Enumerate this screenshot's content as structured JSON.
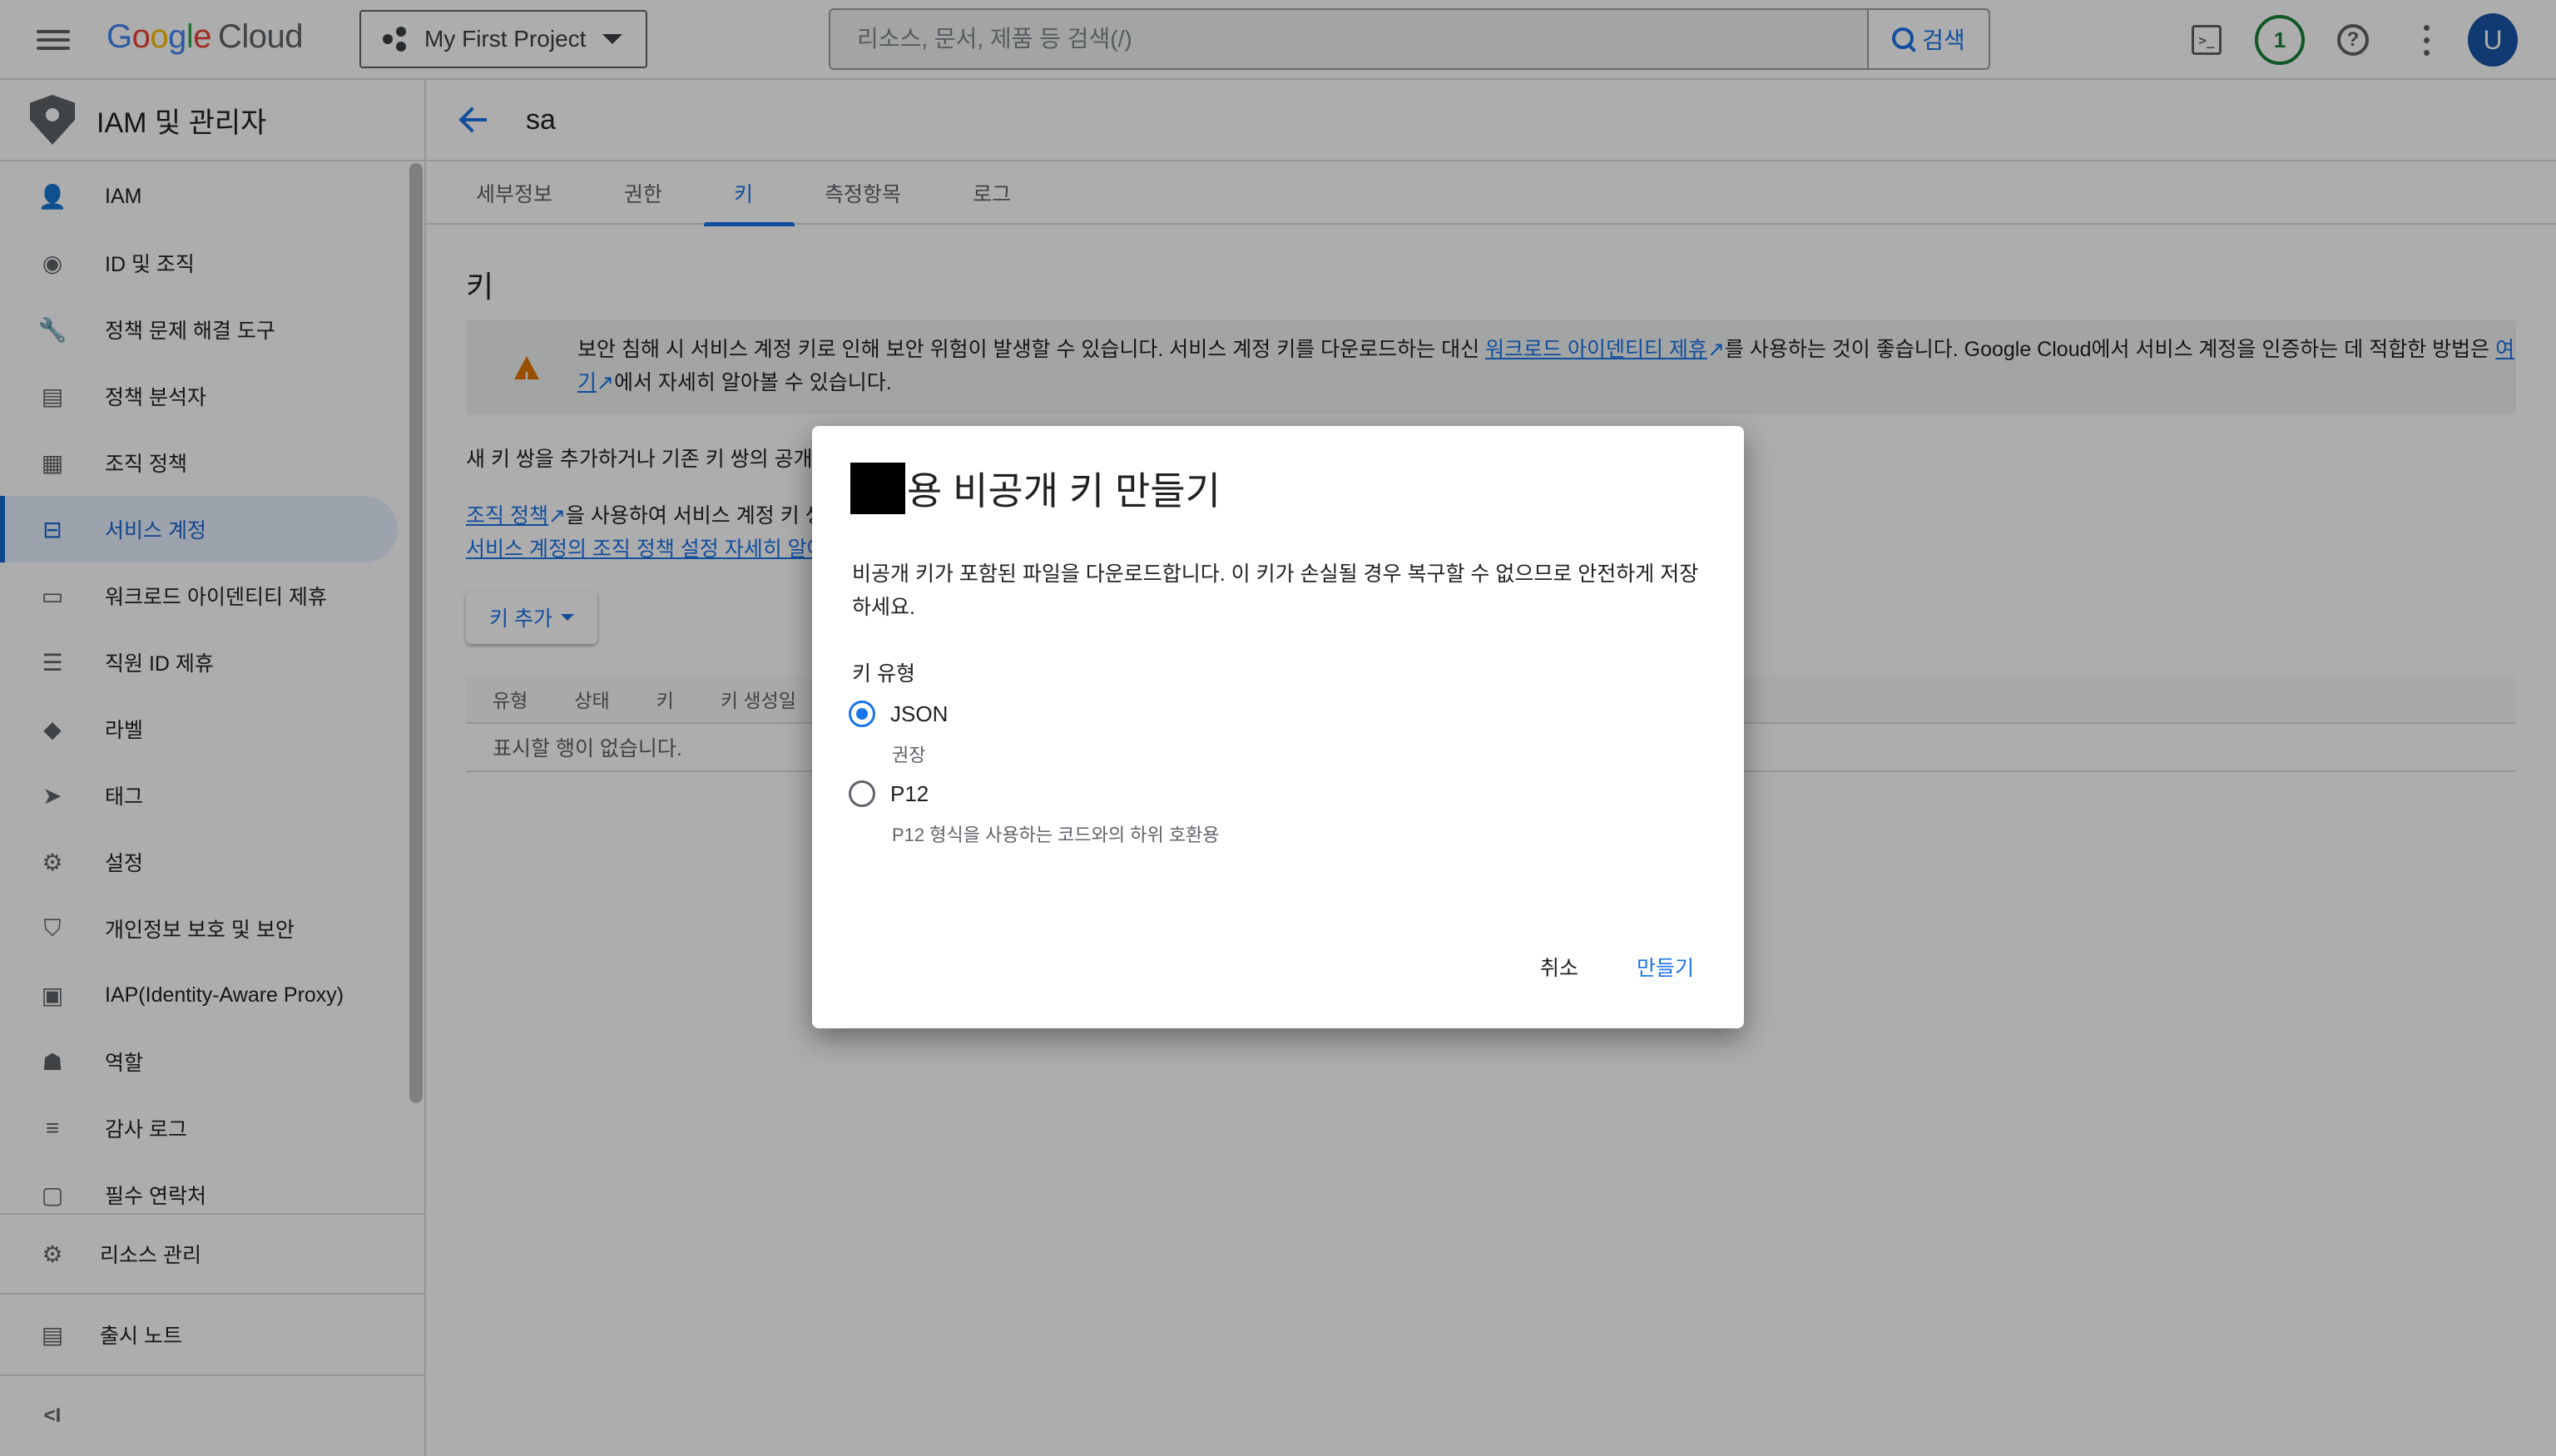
{
  "topbar": {
    "logo": {
      "g": "G",
      "o1": "o",
      "o2": "o",
      "g2": "g",
      "l": "l",
      "e": "e",
      "cloud": "Cloud"
    },
    "project": "My First Project",
    "search_placeholder": "리소스, 문서, 제품 등 검색(/)",
    "search_button": "검색",
    "notification_count": "1",
    "avatar_initial": "U",
    "terminal_glyph": ">_",
    "help_glyph": "?"
  },
  "sidebar": {
    "title": "IAM 및 관리자",
    "items": [
      {
        "label": "IAM",
        "icon": "add-person-icon",
        "glyph": "👤"
      },
      {
        "label": "ID 및 조직",
        "icon": "account-circle-icon",
        "glyph": "◉"
      },
      {
        "label": "정책 문제 해결 도구",
        "icon": "wrench-icon",
        "glyph": "🔧"
      },
      {
        "label": "정책 분석자",
        "icon": "document-search-icon",
        "glyph": "▤"
      },
      {
        "label": "조직 정책",
        "icon": "list-document-icon",
        "glyph": "▦"
      },
      {
        "label": "서비스 계정",
        "icon": "service-account-icon",
        "glyph": "⊟",
        "active": true
      },
      {
        "label": "워크로드 아이덴티티 제휴",
        "icon": "id-card-icon",
        "glyph": "▭"
      },
      {
        "label": "직원 ID 제휴",
        "icon": "list-icon",
        "glyph": "☰"
      },
      {
        "label": "라벨",
        "icon": "tag-icon",
        "glyph": "◆"
      },
      {
        "label": "태그",
        "icon": "label-arrow-icon",
        "glyph": "➤"
      },
      {
        "label": "설정",
        "icon": "gear-icon",
        "glyph": "⚙"
      },
      {
        "label": "개인정보 보호 및 보안",
        "icon": "shield-icon",
        "glyph": "⛉"
      },
      {
        "label": "IAP(Identity-Aware Proxy)",
        "icon": "proxy-icon",
        "glyph": "▣"
      },
      {
        "label": "역할",
        "icon": "hat-icon",
        "glyph": "☗"
      },
      {
        "label": "감사 로그",
        "icon": "lines-icon",
        "glyph": "≡"
      },
      {
        "label": "필수 연락처",
        "icon": "contact-card-icon",
        "glyph": "▢"
      }
    ],
    "manage_resources": "리소스 관리",
    "release_notes": "출시 노트",
    "collapse_glyph": "<I"
  },
  "main": {
    "title": "sa",
    "tabs": [
      "세부정보",
      "권한",
      "키",
      "측정항목",
      "로그"
    ],
    "active_tab": 2,
    "section_title": "키",
    "alert": {
      "text1": "보안 침해 시 서비스 계정 키로 인해 보안 위험이 발생할 수 있습니다. 서비스 계정 키를 다운로드하는 대신 ",
      "link1": "워크로드 아이덴티티 제휴",
      "text2": "를 사용하는 것이 좋습니다. Google Cloud에서 서비스 계정을 인증하는 데 적합한 방법은 ",
      "link2": "여기",
      "text3": "에서 자세히 알아볼 수 있습니다."
    },
    "keypair_text": "새 키 쌍을 추가하거나 기존 키 쌍의 공개키",
    "org_policy_link": "조직 정책",
    "org_policy_text": "을 사용하여 서비스 계정 키 생",
    "org_policy_link2": "서비스 계정의 조직 정책 설정 자세히 알아",
    "add_key": "키 추가",
    "table": {
      "headers": [
        "유형",
        "상태",
        "키",
        "키 생성일"
      ],
      "empty": "표시할 행이 없습니다."
    }
  },
  "dialog": {
    "title": "용 비공개 키 만들기",
    "description": "비공개 키가 포함된 파일을 다운로드합니다. 이 키가 손실될 경우 복구할 수 없으므로 안전하게 저장하세요.",
    "key_type_label": "키 유형",
    "options": [
      {
        "label": "JSON",
        "hint": "권장",
        "checked": true
      },
      {
        "label": "P12",
        "hint": "P12 형식을 사용하는 코드와의 하위 호환용",
        "checked": false
      }
    ],
    "cancel": "취소",
    "create": "만들기"
  }
}
